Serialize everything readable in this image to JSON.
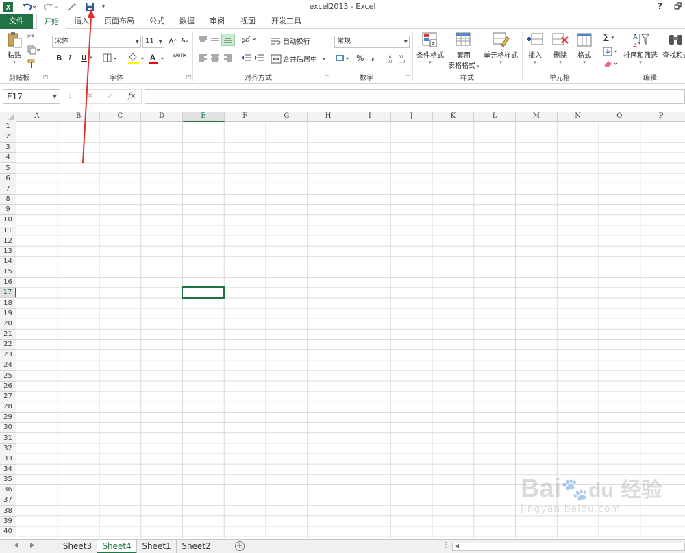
{
  "window": {
    "title": "excel2013 - Excel",
    "help": "?",
    "restore": "🗗"
  },
  "qat": {
    "save_icon": "save-icon"
  },
  "tabs": [
    {
      "label": "文件"
    },
    {
      "label": "开始"
    },
    {
      "label": "插入"
    },
    {
      "label": "页面布局"
    },
    {
      "label": "公式"
    },
    {
      "label": "数据"
    },
    {
      "label": "审阅"
    },
    {
      "label": "视图"
    },
    {
      "label": "开发工具"
    }
  ],
  "ribbon": {
    "clipboard": {
      "paste": "粘贴",
      "label": "剪贴板"
    },
    "font": {
      "name": "宋体",
      "size": "11",
      "bold": "B",
      "italic": "I",
      "underline": "U",
      "grow": "A",
      "shrink": "A",
      "label": "字体",
      "phonetic": "wén"
    },
    "alignment": {
      "wrap": "自动换行",
      "merge": "合并后居中",
      "label": "对齐方式"
    },
    "number": {
      "format": "常规",
      "percent": "%",
      "comma": ",",
      "label": "数字"
    },
    "styles": {
      "conditional": "条件格式",
      "table_1": "套用",
      "table_2": "表格格式",
      "cell": "单元格样式",
      "label": "样式"
    },
    "cells": {
      "insert": "插入",
      "delete": "删除",
      "format": "格式",
      "label": "单元格"
    },
    "editing": {
      "sort": "排序和筛选",
      "find": "查找和选",
      "label": "编辑"
    }
  },
  "formula_bar": {
    "name_box": "E17",
    "fx": "fx",
    "cancel": "✕",
    "enter": "✓",
    "value": ""
  },
  "columns": [
    "A",
    "B",
    "C",
    "D",
    "E",
    "F",
    "G",
    "H",
    "I",
    "J",
    "K",
    "L",
    "M",
    "N",
    "O",
    "P"
  ],
  "rows": [
    "1",
    "2",
    "3",
    "4",
    "5",
    "6",
    "7",
    "8",
    "9",
    "10",
    "11",
    "12",
    "13",
    "14",
    "15",
    "16",
    "17",
    "18",
    "19",
    "20",
    "21",
    "22",
    "23",
    "24",
    "25",
    "26",
    "27",
    "28",
    "29",
    "30",
    "31",
    "32",
    "33",
    "34",
    "35",
    "36",
    "37",
    "38",
    "39",
    "40"
  ],
  "active_cell": {
    "column": "E",
    "row": "17"
  },
  "sheets": [
    {
      "label": "Sheet3"
    },
    {
      "label": "Sheet4"
    },
    {
      "label": "Sheet1"
    },
    {
      "label": "Sheet2"
    }
  ],
  "active_sheet": "Sheet4",
  "add_sheet": "+",
  "watermark": {
    "brand": "Bai",
    "brand2": "经验",
    "url": "jingyan.baidu.com"
  },
  "colors": {
    "accent": "#217346",
    "annotation": "#e0302a"
  }
}
